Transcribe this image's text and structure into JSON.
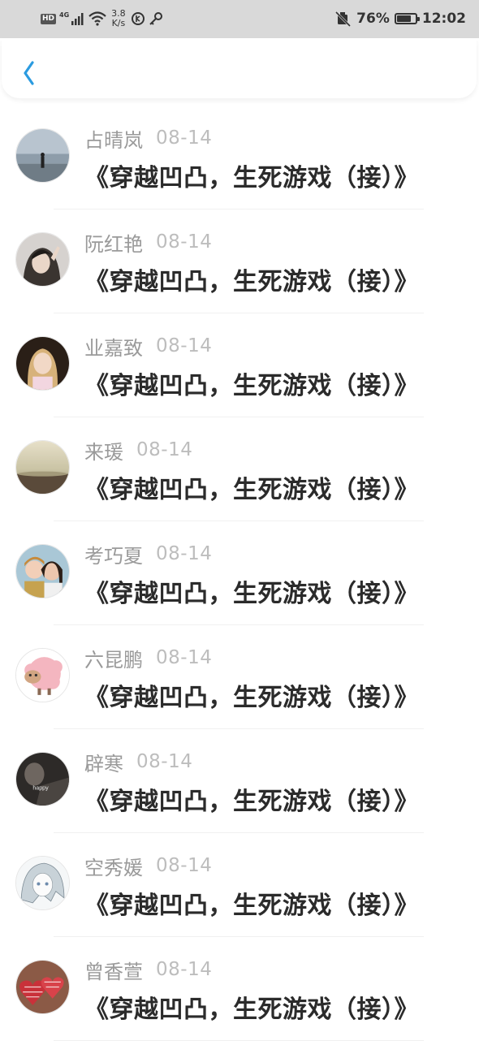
{
  "status_bar": {
    "hd": "HD",
    "network": "4G",
    "speed_value": "3.8",
    "speed_unit": "K/s",
    "battery_percent": "76%",
    "battery_level": 0.76,
    "time": "12:02"
  },
  "header": {
    "back_icon": "chevron-left-icon",
    "accent_color": "#2b9be0"
  },
  "items": [
    {
      "name": "占晴岚",
      "date": "08-14",
      "title": "《穿越凹凸，生死游戏（接）》",
      "avatar": "beach-figure"
    },
    {
      "name": "阮红艳",
      "date": "08-14",
      "title": "《穿越凹凸，生死游戏（接）》",
      "avatar": "person-waving"
    },
    {
      "name": "业嘉致",
      "date": "08-14",
      "title": "《穿越凹凸，生死游戏（接）》",
      "avatar": "blonde-girl"
    },
    {
      "name": "来瑗",
      "date": "08-14",
      "title": "《穿越凹凸，生死游戏（接）》",
      "avatar": "sunset-landscape"
    },
    {
      "name": "考巧夏",
      "date": "08-14",
      "title": "《穿越凹凸，生死游戏（接）》",
      "avatar": "two-girls"
    },
    {
      "name": "六昆鹏",
      "date": "08-14",
      "title": "《穿越凹凸，生死游戏（接）》",
      "avatar": "cartoon-sheep"
    },
    {
      "name": "辟寒",
      "date": "08-14",
      "title": "《穿越凹凸，生死游戏（接）》",
      "avatar": "dark-happy"
    },
    {
      "name": "空秀媛",
      "date": "08-14",
      "title": "《穿越凹凸，生死游戏（接）》",
      "avatar": "anime-sketch"
    },
    {
      "name": "曾香萱",
      "date": "08-14",
      "title": "《穿越凹凸，生死游戏（接）》",
      "avatar": "knitted-hearts"
    }
  ]
}
